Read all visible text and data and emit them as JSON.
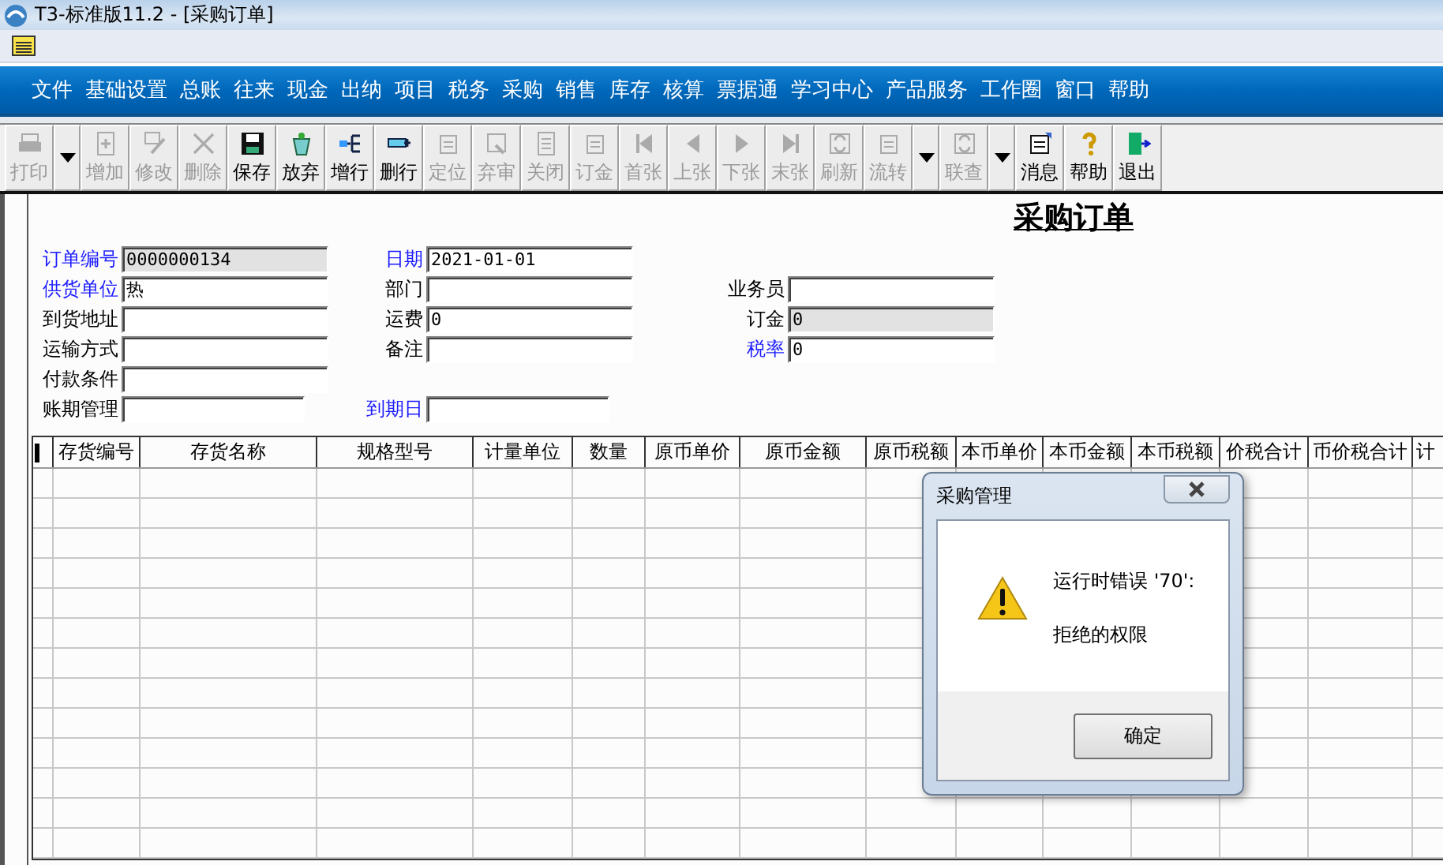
{
  "window": {
    "title": "T3-标准版11.2 - [采购订单]"
  },
  "menu": [
    "文件",
    "基础设置",
    "总账",
    "往来",
    "现金",
    "出纳",
    "项目",
    "税务",
    "采购",
    "销售",
    "库存",
    "核算",
    "票据通",
    "学习中心",
    "产品服务",
    "工作圈",
    "窗口",
    "帮助"
  ],
  "toolbar": [
    {
      "kind": "button",
      "label": "打印",
      "disabled": true
    },
    {
      "kind": "dropdown"
    },
    {
      "kind": "button",
      "label": "增加",
      "disabled": true
    },
    {
      "kind": "button",
      "label": "修改",
      "disabled": true
    },
    {
      "kind": "button",
      "label": "删除",
      "disabled": true
    },
    {
      "kind": "button",
      "label": "保存",
      "disabled": false
    },
    {
      "kind": "button",
      "label": "放弃",
      "disabled": false
    },
    {
      "kind": "button",
      "label": "增行",
      "disabled": false
    },
    {
      "kind": "button",
      "label": "删行",
      "disabled": false
    },
    {
      "kind": "button",
      "label": "定位",
      "disabled": true
    },
    {
      "kind": "button",
      "label": "弃审",
      "disabled": true
    },
    {
      "kind": "button",
      "label": "关闭",
      "disabled": true
    },
    {
      "kind": "button",
      "label": "订金",
      "disabled": true
    },
    {
      "kind": "button",
      "label": "首张",
      "disabled": true
    },
    {
      "kind": "button",
      "label": "上张",
      "disabled": true
    },
    {
      "kind": "button",
      "label": "下张",
      "disabled": true
    },
    {
      "kind": "button",
      "label": "末张",
      "disabled": true
    },
    {
      "kind": "button",
      "label": "刷新",
      "disabled": true
    },
    {
      "kind": "button",
      "label": "流转",
      "disabled": true
    },
    {
      "kind": "dropdown"
    },
    {
      "kind": "button",
      "label": "联查",
      "disabled": true
    },
    {
      "kind": "dropdown"
    },
    {
      "kind": "button",
      "label": "消息",
      "disabled": false
    },
    {
      "kind": "button",
      "label": "帮助",
      "disabled": false
    },
    {
      "kind": "button",
      "label": "退出",
      "disabled": false
    }
  ],
  "form": {
    "title": "采购订单",
    "rows": [
      [
        {
          "label": "订单编号",
          "value": "0000000134",
          "required": true,
          "disabled": true
        },
        {
          "label": "日期",
          "value": "2021-01-01",
          "required": true,
          "disabled": false
        }
      ],
      [
        {
          "label": "供货单位",
          "value": "热",
          "required": true,
          "disabled": false
        },
        {
          "label": "部门",
          "required": false,
          "disabled": false
        },
        {
          "label": "业务员",
          "required": false,
          "disabled": false
        }
      ],
      [
        {
          "label": "到货地址",
          "required": false,
          "disabled": false
        },
        {
          "label": "运费",
          "value": "0",
          "required": false,
          "disabled": false
        },
        {
          "label": "订金",
          "value": "0",
          "required": false,
          "disabled": true
        }
      ],
      [
        {
          "label": "运输方式",
          "required": false,
          "disabled": false
        },
        {
          "label": "备注",
          "required": false,
          "disabled": false
        },
        {
          "label": "税率",
          "value": "0",
          "required": true,
          "disabled": false
        }
      ],
      [
        {
          "label": "付款条件",
          "required": false,
          "disabled": false
        }
      ],
      [
        {
          "label": "账期管理",
          "required": false,
          "disabled": false,
          "kind": "short"
        },
        {
          "label": "到期日",
          "required": true,
          "disabled": false,
          "kind": "short"
        }
      ]
    ]
  },
  "table": {
    "columns": [
      "存货编号",
      "存货名称",
      "规格型号",
      "计量单位",
      "数量",
      "原币单价",
      "原币金额",
      "原币税额",
      "本币单价",
      "本币金额",
      "本币税额",
      "价税合计",
      "币价税合计",
      "计"
    ]
  },
  "dialog": {
    "title": "采购管理",
    "message": [
      "运行时错误 '70':",
      "拒绝的权限"
    ],
    "button": "确定"
  }
}
